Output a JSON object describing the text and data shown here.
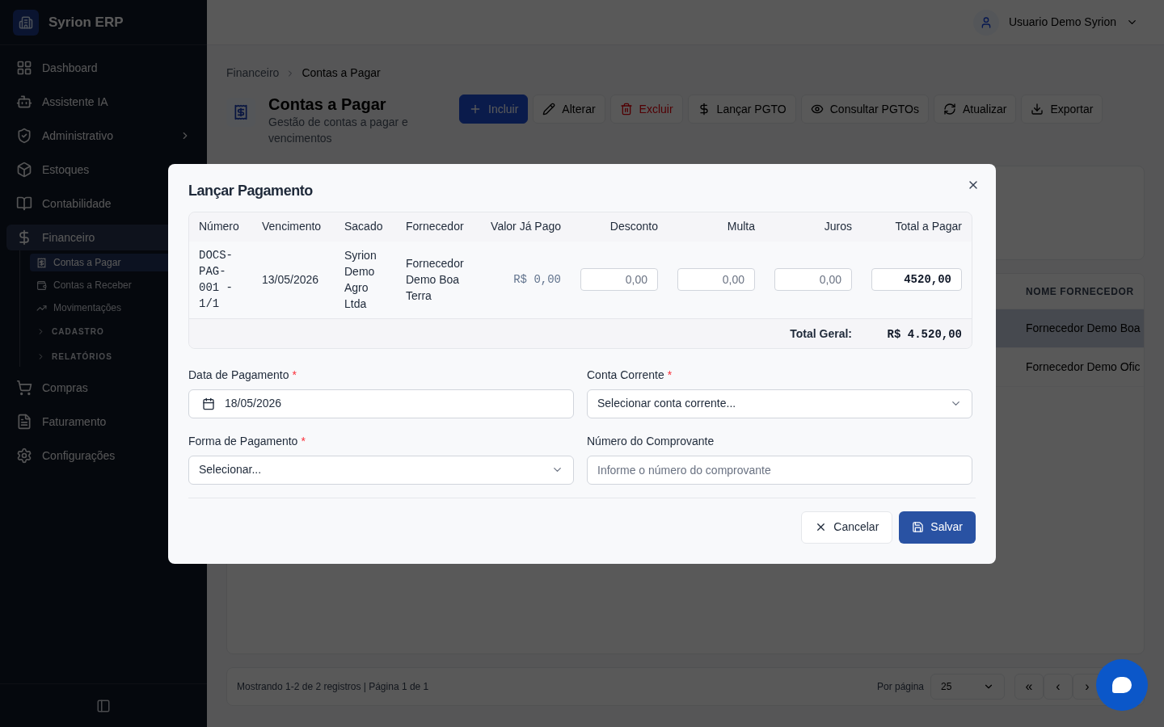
{
  "sidebar": {
    "brand": "Syrion ERP",
    "items": [
      {
        "label": "Dashboard",
        "selected": false
      },
      {
        "label": "Assistente IA",
        "selected": false
      },
      {
        "label": "Administrativo",
        "selected": false,
        "expanded": false
      },
      {
        "label": "Estoques",
        "selected": false
      },
      {
        "label": "Contabilidade",
        "selected": false
      },
      {
        "label": "Financeiro",
        "selected": true,
        "expanded": true,
        "children": [
          {
            "kind": "link",
            "label": "Contas a Pagar",
            "selected": true
          },
          {
            "kind": "link",
            "label": "Contas a Receber",
            "selected": false
          },
          {
            "kind": "link",
            "label": "Movimentações",
            "selected": false
          },
          {
            "kind": "section",
            "label": "CADASTRO"
          },
          {
            "kind": "section",
            "label": "RELATÓRIOS"
          }
        ]
      },
      {
        "label": "Compras",
        "selected": false
      },
      {
        "label": "Faturamento",
        "selected": false
      },
      {
        "label": "Configurações",
        "selected": false
      }
    ]
  },
  "header": {
    "user": "Usuario Demo Syrion"
  },
  "breadcrumb": [
    "Financeiro",
    "Contas a Pagar"
  ],
  "page": {
    "title": "Contas a Pagar",
    "subtitle": "Gestão de contas a pagar e vencimentos"
  },
  "toolbar": [
    {
      "label": "Incluir",
      "kind": "primary"
    },
    {
      "label": "Alterar",
      "kind": "default"
    },
    {
      "label": "Excluir",
      "kind": "danger"
    },
    {
      "label": "Lançar PGTO",
      "kind": "default"
    },
    {
      "label": "Consultar PGTOs",
      "kind": "default"
    },
    {
      "label": "Atualizar",
      "kind": "default"
    },
    {
      "label": "Exportar",
      "kind": "default"
    }
  ],
  "table": {
    "column": "NOME FORNECEDOR",
    "rows": [
      {
        "fornecedor": "Fornecedor Demo Boa",
        "selected": true
      },
      {
        "fornecedor": "Fornecedor Demo Ofic",
        "selected": false
      }
    ]
  },
  "pagination": {
    "summary": "Mostrando 1-2 de 2 registros | Página 1 de 1",
    "per_page_label": "Por página",
    "per_page": "25",
    "buttons": [
      "«",
      "‹",
      "›"
    ]
  },
  "dialog": {
    "title": "Lançar Pagamento",
    "columns": [
      "Número",
      "Vencimento",
      "Sacado",
      "Fornecedor",
      "Valor Já Pago",
      "Desconto",
      "Multa",
      "Juros",
      "Total a Pagar"
    ],
    "row": [
      {
        "kind": "mono",
        "text": "DOCS-PAG-001 - 1/1"
      },
      {
        "kind": "text",
        "text": "13/05/2026"
      },
      {
        "kind": "text",
        "text": "Syrion Demo Agro Ltda"
      },
      {
        "kind": "text",
        "text": "Fornecedor Demo Boa Terra"
      },
      {
        "kind": "muted",
        "text": "R$ 0,00"
      },
      {
        "kind": "input",
        "placeholder": "0,00"
      },
      {
        "kind": "input",
        "placeholder": "0,00"
      },
      {
        "kind": "input",
        "placeholder": "0,00"
      },
      {
        "kind": "total",
        "value": "4520,00"
      }
    ],
    "total_label": "Total Geral:",
    "total_value": "R$ 4.520,00",
    "required_mark": "*",
    "fields": [
      {
        "label": "Data de Pagamento",
        "required": true,
        "kind": "date",
        "value": "18/05/2026"
      },
      {
        "label": "Conta Corrente",
        "required": true,
        "kind": "select",
        "value": "Selecionar conta corrente..."
      },
      {
        "label": "Forma de Pagamento",
        "required": true,
        "kind": "select",
        "value": "Selecionar..."
      },
      {
        "label": "Número do Comprovante",
        "required": false,
        "kind": "text",
        "placeholder": "Informe o número do comprovante"
      }
    ],
    "cancel": "Cancelar",
    "save": "Salvar"
  }
}
